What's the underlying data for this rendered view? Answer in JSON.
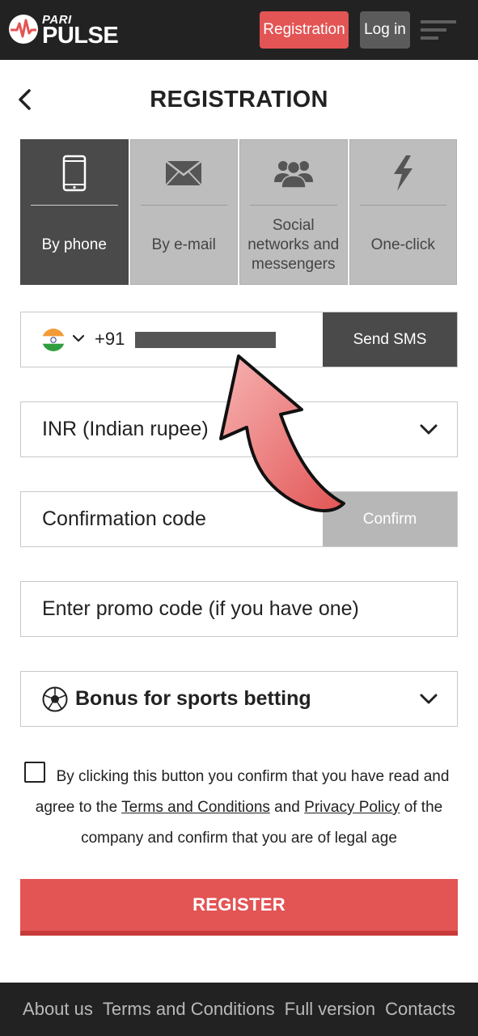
{
  "header": {
    "logo_top": "PARI",
    "logo_bottom": "PULSE",
    "registration_label": "Registration",
    "login_label": "Log in",
    "menu_icon": "hamburger-menu-icon",
    "bg_color": "#222222",
    "accent_color": "#e35454"
  },
  "page": {
    "title": "REGISTRATION",
    "back_icon": "chevron-left-icon"
  },
  "tabs": [
    {
      "label": "By phone",
      "icon": "smartphone-icon",
      "active": true
    },
    {
      "label": "By e-mail",
      "icon": "envelope-icon",
      "active": false
    },
    {
      "label": "Social networks and messengers",
      "icon": "users-icon",
      "active": false
    },
    {
      "label": "One-click",
      "icon": "lightning-icon",
      "active": false
    }
  ],
  "phone": {
    "flag_icon": "india-flag-icon",
    "dial_code": "+91",
    "send_sms_label": "Send SMS"
  },
  "currency": {
    "selected": "INR (Indian rupee)"
  },
  "confirmation": {
    "placeholder": "Confirmation code",
    "confirm_label": "Confirm"
  },
  "promo": {
    "placeholder": "Enter promo code (if you have one)"
  },
  "bonus": {
    "selected": "Bonus for sports betting",
    "icon": "soccer-ball-icon"
  },
  "agreement": {
    "checked": false,
    "text_1": "By clicking this button you confirm that you have read and agree to the",
    "terms_link": "Terms and Conditions",
    "text_2": "and",
    "privacy_link": "Privacy Policy",
    "text_3": "of the company and confirm that you are of legal age"
  },
  "register_label": "REGISTER",
  "footer": {
    "links": [
      "About us",
      "Terms and Conditions",
      "Full version",
      "Contacts"
    ]
  }
}
